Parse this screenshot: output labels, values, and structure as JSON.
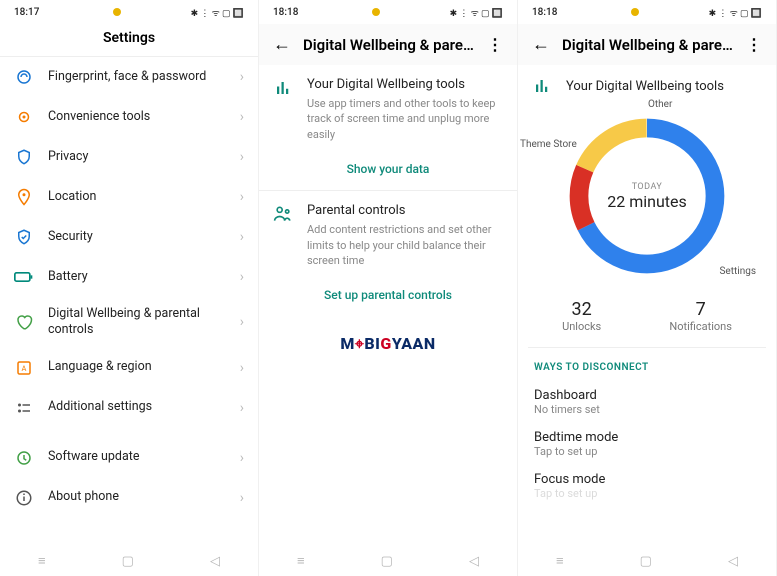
{
  "panel1": {
    "status_time": "18:17",
    "header": "Settings",
    "items": [
      {
        "label": "Fingerprint, face & password",
        "icon": "fingerprint",
        "color": "#1976d2"
      },
      {
        "label": "Convenience tools",
        "icon": "tools",
        "color": "#f57c00"
      },
      {
        "label": "Privacy",
        "icon": "privacy",
        "color": "#1976d2"
      },
      {
        "label": "Location",
        "icon": "location",
        "color": "#f57c00"
      },
      {
        "label": "Security",
        "icon": "security",
        "color": "#1976d2"
      },
      {
        "label": "Battery",
        "icon": "battery",
        "color": "#00897b"
      },
      {
        "label": "Digital Wellbeing & parental controls",
        "icon": "wellbeing",
        "color": "#43a047"
      },
      {
        "label": "Language & region",
        "icon": "language",
        "color": "#f57c00"
      },
      {
        "label": "Additional settings",
        "icon": "additional",
        "color": "#555"
      }
    ],
    "items2": [
      {
        "label": "Software update",
        "icon": "update",
        "color": "#43a047"
      },
      {
        "label": "About phone",
        "icon": "about",
        "color": "#555"
      }
    ]
  },
  "panel2": {
    "status_time": "18:18",
    "header": "Digital Wellbeing & paren…",
    "wellbeing": {
      "title": "Your Digital Wellbeing tools",
      "desc": "Use app timers and other tools to keep track of screen time and unplug more easily",
      "action": "Show your data"
    },
    "parental": {
      "title": "Parental controls",
      "desc": "Add content restrictions and set other limits to help your child balance their screen time",
      "action": "Set up parental controls"
    },
    "brand": "MOBIGYAAN"
  },
  "panel3": {
    "status_time": "18:18",
    "header": "Digital Wellbeing & paren…",
    "title": "Your Digital Wellbeing tools",
    "ring": {
      "today_label": "TODAY",
      "today_value": "22 minutes",
      "labels": {
        "theme": "Theme Store",
        "other": "Other",
        "settings": "Settings"
      }
    },
    "stats": {
      "unlocks_num": "32",
      "unlocks_cap": "Unlocks",
      "notif_num": "7",
      "notif_cap": "Notifications"
    },
    "ways_header": "WAYS TO DISCONNECT",
    "ways": [
      {
        "t": "Dashboard",
        "s": "No timers set"
      },
      {
        "t": "Bedtime mode",
        "s": "Tap to set up"
      },
      {
        "t": "Focus mode",
        "s": "Tap to set up"
      }
    ]
  },
  "chart_data": {
    "type": "pie",
    "title": "Today screen time breakdown",
    "total_label": "22 minutes",
    "series": [
      {
        "name": "Settings",
        "value": 68,
        "color": "#2f81ec"
      },
      {
        "name": "Other",
        "value": 18,
        "color": "#f7c948"
      },
      {
        "name": "Theme Store",
        "value": 14,
        "color": "#d93025"
      }
    ]
  }
}
